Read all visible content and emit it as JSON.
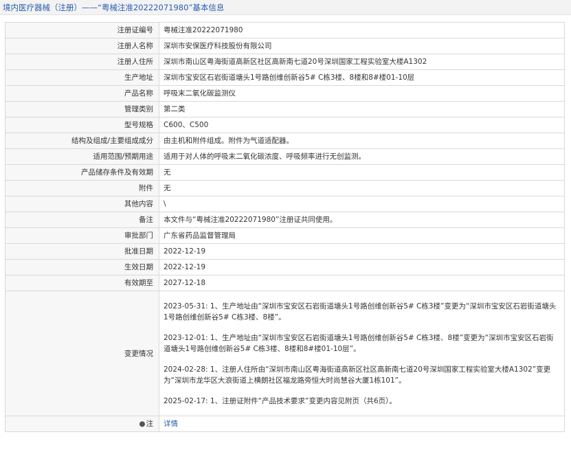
{
  "header": {
    "title": "境内医疗器械（注册）——“粤械注准20222071980”基本信息"
  },
  "rows": [
    {
      "label": "注册证编号",
      "value": "粤械注准20222071980"
    },
    {
      "label": "注册人名称",
      "value": "深圳市安保医疗科技股份有限公司"
    },
    {
      "label": "注册人住所",
      "value": "深圳市南山区粤海街道高新区社区高新南七道20号深圳国家工程实验室大楼A1302"
    },
    {
      "label": "生产地址",
      "value": "深圳市宝安区石岩街道塘头1号路创维创新谷5# C栋3楼、8楼和8#楼01-10层"
    },
    {
      "label": "产品名称",
      "value": "呼吸末二氧化碳监测仪"
    },
    {
      "label": "管理类别",
      "value": "第二类"
    },
    {
      "label": "型号规格",
      "value": "C600、C500"
    },
    {
      "label": "结构及组成/主要组成成分",
      "value": "由主机和附件组成。附件为气道适配器。"
    },
    {
      "label": "适用范围/预期用途",
      "value": "适用于对人体的呼吸末二氧化碳浓度、呼吸频率进行无创监测。"
    },
    {
      "label": "产品储存条件及有效期",
      "value": "无"
    },
    {
      "label": "附件",
      "value": "无"
    },
    {
      "label": "其他内容",
      "value": "\\"
    },
    {
      "label": "备注",
      "value": "本文件与“粤械注准20222071980”注册证共同使用。"
    },
    {
      "label": "审批部门",
      "value": "广东省药品监督管理局"
    },
    {
      "label": "批准日期",
      "value": "2022-12-19"
    },
    {
      "label": "生效日期",
      "value": "2022-12-19"
    },
    {
      "label": "有效期至",
      "value": "2027-12-18"
    }
  ],
  "changes": {
    "label": "变更情况",
    "entries": [
      "2023-05-31: 1、生产地址由“深圳市宝安区石岩街道塘头1号路创维创新谷5# C栋3楼”变更为“深圳市宝安区石岩街道塘头1号路创维创新谷5# C栋3楼、8楼”。",
      "2023-12-01: 1、生产地址由“深圳市宝安区石岩街道塘头1号路创维创新谷5# C栋3楼、8楼”变更为“深圳市宝安区石岩街道塘头1号路创维创新谷5# C栋3楼、8楼和8#楼01-10层”。",
      "2024-02-28: 1、注册人住所由“深圳市南山区粤海街道高新区社区高新南七道20号深圳国家工程实验室大楼A1302”变更为“深圳市龙华区大浪街道上横朗社区福龙路旁恒大时尚慧谷大厦1栋101”。",
      "2025-02-17: 1、注册证附件“产品技术要求”变更内容见附页（共6页）。"
    ]
  },
  "note": {
    "icon": "●",
    "label": "注",
    "link_text": "详情"
  }
}
